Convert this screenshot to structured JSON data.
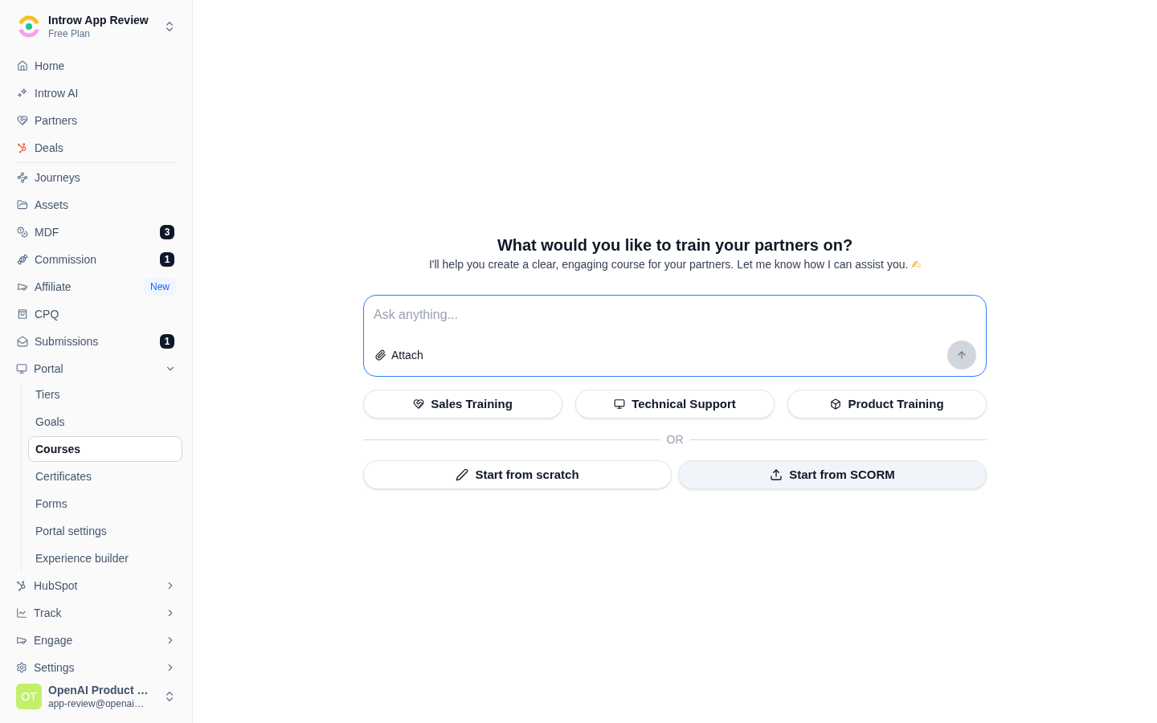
{
  "workspace": {
    "name": "Introw App Review",
    "plan": "Free Plan"
  },
  "nav_primary": [
    {
      "label": "Home",
      "selected": false
    },
    {
      "label": "Introw AI",
      "selected": false
    },
    {
      "label": "Partners",
      "selected": false
    },
    {
      "label": "Deals",
      "selected": false
    }
  ],
  "nav_secondary": [
    {
      "label": "Journeys",
      "selected": false
    },
    {
      "label": "Assets",
      "selected": false
    },
    {
      "label": "MDF",
      "selected": false,
      "badge": {
        "kind": "count",
        "text": "3"
      }
    },
    {
      "label": "Commission",
      "selected": false,
      "badge": {
        "kind": "count",
        "text": "1"
      }
    },
    {
      "label": "Affiliate",
      "selected": false,
      "badge": {
        "kind": "new",
        "text": "New"
      }
    },
    {
      "label": "CPQ",
      "selected": false
    },
    {
      "label": "Submissions",
      "selected": false,
      "badge": {
        "kind": "count",
        "text": "1"
      }
    }
  ],
  "nav_groups": [
    {
      "label": "Portal",
      "expanded": true,
      "children": [
        {
          "label": "Tiers",
          "selected": false
        },
        {
          "label": "Goals",
          "selected": false
        },
        {
          "label": "Courses",
          "selected": true
        },
        {
          "label": "Certificates",
          "selected": false
        },
        {
          "label": "Forms",
          "selected": false
        },
        {
          "label": "Portal settings",
          "selected": false
        },
        {
          "label": "Experience builder",
          "selected": false
        }
      ]
    },
    {
      "label": "HubSpot",
      "expanded": false
    },
    {
      "label": "Track",
      "expanded": false
    },
    {
      "label": "Engage",
      "expanded": false
    },
    {
      "label": "Settings",
      "expanded": false
    }
  ],
  "user": {
    "initials": "OT",
    "name": "OpenAI Product …",
    "email": "app-review@openai…"
  },
  "main": {
    "title": "What would you like to train your partners on?",
    "subtitle": "I'll help you create a clear, engaging course for your partners. Let me know how I can assist you.",
    "subtitle_emoji": "✍",
    "composer": {
      "placeholder": "Ask anything...",
      "attach_label": "Attach",
      "send_disabled": true
    },
    "suggestions": [
      {
        "label": "Sales Training"
      },
      {
        "label": "Technical Support"
      },
      {
        "label": "Product Training"
      }
    ],
    "separator": "OR",
    "actions": [
      {
        "label": "Start from scratch",
        "hovered": false
      },
      {
        "label": "Start from SCORM",
        "hovered": true
      }
    ]
  }
}
